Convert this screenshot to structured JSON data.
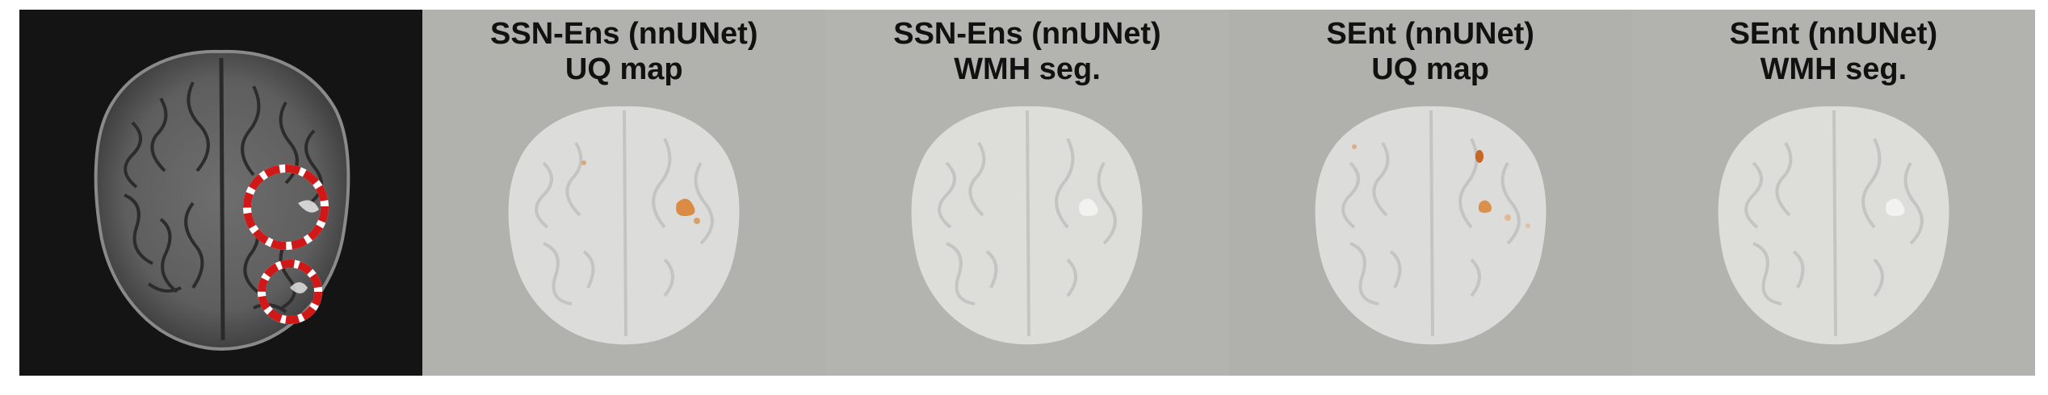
{
  "panels": [
    {
      "id": "flair-input",
      "title_line1": "",
      "title_line2": "",
      "theme": "dark",
      "highlight_circles": 2
    },
    {
      "id": "ssn-ens-uq",
      "title_line1": "SSN-Ens (nnUNet)",
      "title_line2": "UQ map",
      "theme": "grey",
      "overlay": "uncertainty-orange"
    },
    {
      "id": "ssn-ens-seg",
      "title_line1": "SSN-Ens (nnUNet)",
      "title_line2": "WMH seg.",
      "theme": "grey",
      "overlay": "none"
    },
    {
      "id": "sent-uq",
      "title_line1": "SEnt (nnUNet)",
      "title_line2": "UQ map",
      "theme": "grey",
      "overlay": "uncertainty-orange"
    },
    {
      "id": "sent-seg",
      "title_line1": "SEnt (nnUNet)",
      "title_line2": "WMH seg.",
      "theme": "grey",
      "overlay": "none"
    }
  ],
  "colors": {
    "dark_background": "#141414",
    "grey_background": "#b2b3af",
    "highlight_circle": "#d01818",
    "uncertainty": "#d9781e",
    "title_text": "#111111"
  }
}
